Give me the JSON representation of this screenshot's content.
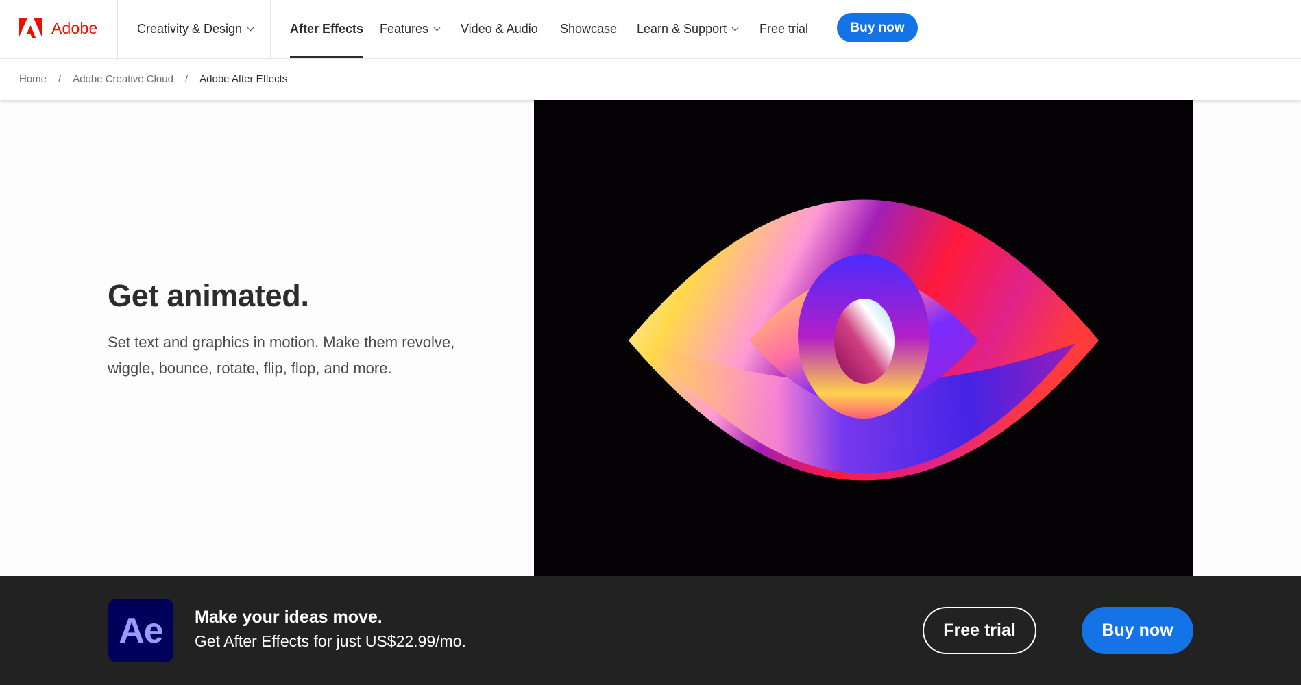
{
  "brand": {
    "name": "Adobe",
    "logo_icon": "adobe-logo-icon",
    "color": "#eb1000"
  },
  "nav": {
    "items": [
      {
        "label": "Creativity & Design",
        "has_dropdown": true
      },
      {
        "label": "After Effects",
        "active": true
      },
      {
        "label": "Features",
        "has_dropdown": true
      },
      {
        "label": "Video & Audio"
      },
      {
        "label": "Showcase"
      },
      {
        "label": "Learn & Support",
        "has_dropdown": true
      },
      {
        "label": "Free trial"
      }
    ],
    "buy_label": "Buy now",
    "accent": "#1473e6"
  },
  "breadcrumb": {
    "items": [
      "Home",
      "Adobe Creative Cloud",
      "Adobe After Effects"
    ],
    "separator": "/"
  },
  "hero": {
    "title": "Get animated.",
    "description": "Set text and graphics in motion. Make them revolve, wiggle, bounce, rotate, flip, flop, and more.",
    "media": "animated-eye-video"
  },
  "banner": {
    "app_icon_text": "Ae",
    "title": "Make your ideas move.",
    "subtitle": "Get After Effects for just US$22.99/mo.",
    "free_trial_label": "Free trial",
    "buy_label": "Buy now",
    "background": "#222222"
  }
}
